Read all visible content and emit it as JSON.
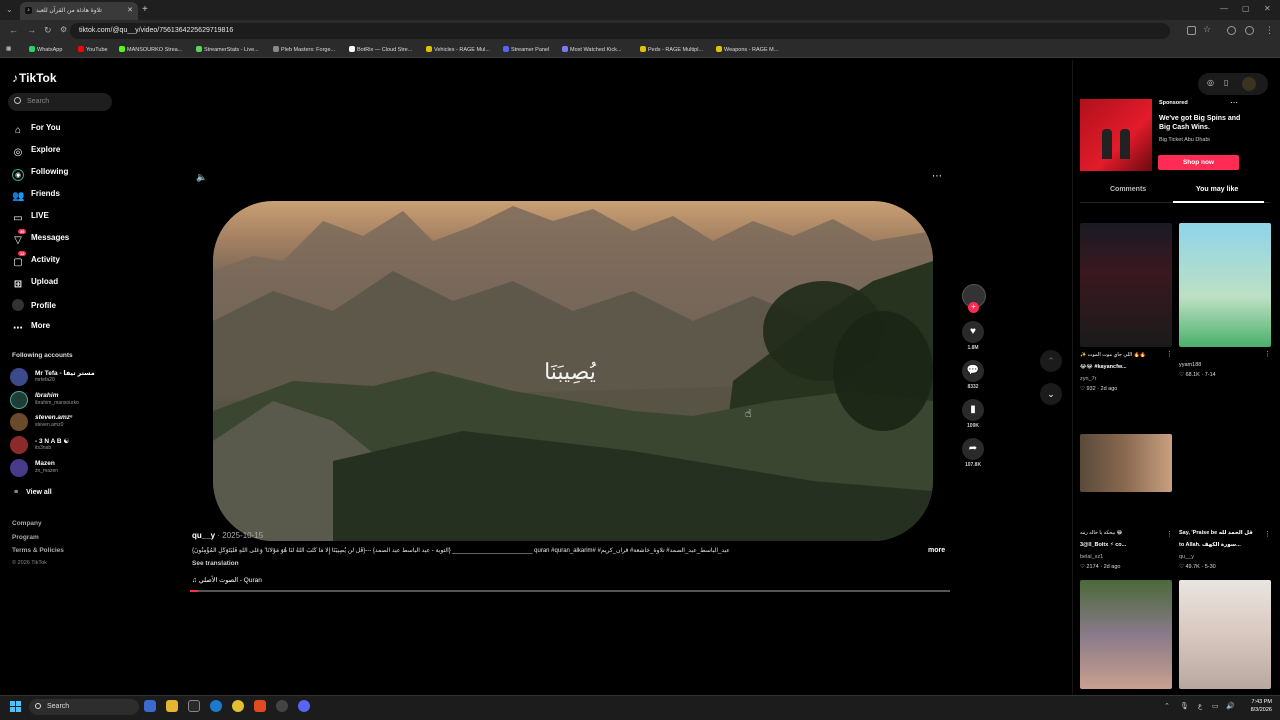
{
  "browser": {
    "tab_title": "تلاوة هادئة من القرآن للعبد",
    "tab_icon": "tiktok-icon",
    "url": "tiktok.com/@qu__y/video/7561364225629719816",
    "bookmarks": [
      {
        "label": "WhatsApp",
        "color": "#25d366"
      },
      {
        "label": "YouTube",
        "color": "#ff0000"
      },
      {
        "label": "MANSOURKO Strea...",
        "color": "#53fc18"
      },
      {
        "label": "StreamerStats - Live...",
        "color": "#5ad35a"
      },
      {
        "label": "Pleb Masters: Forge...",
        "color": "#888888"
      },
      {
        "label": "BotRix — Cloud Stre...",
        "color": "#ffffff"
      },
      {
        "label": "Vehicles - RAGE Mul...",
        "color": "#e0c000"
      },
      {
        "label": "Streamer Panel",
        "color": "#5865f2"
      },
      {
        "label": "Most Watched Kick...",
        "color": "#7a7aff"
      },
      {
        "label": "Peds - RAGE Multipl...",
        "color": "#e0c000"
      },
      {
        "label": "Weapons - RAGE M...",
        "color": "#e0c000"
      }
    ]
  },
  "sidebar": {
    "logo": "TikTok",
    "search_placeholder": "Search",
    "nav": [
      {
        "label": "For You",
        "icon": "home-icon"
      },
      {
        "label": "Explore",
        "icon": "compass-icon"
      },
      {
        "label": "Following",
        "icon": "following-icon"
      },
      {
        "label": "Friends",
        "icon": "friends-icon"
      },
      {
        "label": "LIVE",
        "icon": "live-icon"
      },
      {
        "label": "Messages",
        "icon": "messages-icon",
        "badge": "36"
      },
      {
        "label": "Activity",
        "icon": "activity-icon",
        "badge": "12"
      },
      {
        "label": "Upload",
        "icon": "upload-icon"
      },
      {
        "label": "Profile",
        "icon": "profile-icon"
      },
      {
        "label": "More",
        "icon": "more-icon"
      }
    ],
    "following_heading": "Following accounts",
    "accounts": [
      {
        "name": "Mr Tefa - مستر تيفا",
        "handle": "mrtefa20",
        "color": "#3b4a8a"
      },
      {
        "name": "Ibrahim",
        "handle": "ibrahim_mansourko",
        "color": "#2f6f5f"
      },
      {
        "name": "steven.amz⁶",
        "handle": "steven.amz0",
        "color": "#6b4a2a"
      },
      {
        "name": "- 3 N A B ☯",
        "handle": "its3nab",
        "color": "#8a2a2a"
      },
      {
        "name": "Mazen",
        "handle": "zn_mazen",
        "color": "#4a3a8a"
      }
    ],
    "view_all": "View all",
    "footer": [
      "Company",
      "Program",
      "Terms & Policies"
    ],
    "copyright": "© 2026 TikTok"
  },
  "video": {
    "overlay_text": "يُصِيبَنَا",
    "username": "qu__y",
    "date": "2025-10-15",
    "caption": "عبد_الباسط_عبد_الصمد# تلاوة_خاشعة# قرآن_كريم# #quran #quran_alkarim ________________________ {التوبة - عبد الباسط عبد الصمد} ---{قُل لَّن يُصِيبَنَا إِلَّا مَا كَتَبَ اللَّهُ لَنَا هُوَ مَوْلَانَا ۚ وَعَلَى اللَّهِ فَلْيَتَوَكَّلِ الْمُؤْمِنُونَ}",
    "more": "more",
    "see_translation": "See translation",
    "music": "الصوت الأصلي - Quran",
    "progress": 0.01,
    "likes": "1.8M",
    "comments": "8332",
    "saves": "109K",
    "shares": "107.8K"
  },
  "ad": {
    "sponsored": "Sponsored",
    "title": "We've got Big Spins and Big Cash Wins.",
    "advertiser": "Big Ticket Abu Dhabi",
    "cta": "Shop now"
  },
  "right_tabs": {
    "comments": "Comments",
    "you_may_like": "You may like"
  },
  "recommended": [
    {
      "caption": "😂😂 #kayancfw...",
      "caption_pre": "🔥🔥 اللي جاي موت الموت ✨",
      "user": "zyn_7r",
      "likes": "932",
      "date": "2d ago"
    },
    {
      "caption": "",
      "caption_pre": "",
      "user": "yyam188",
      "likes": "68.1K",
      "date": "7-14"
    },
    {
      "caption": "3@ll_Boltx ⚡ co...",
      "caption_pre": "😂 بيحكه يا خاله رمه",
      "user": "belal_xz1",
      "likes": "2174",
      "date": "2d ago"
    },
    {
      "caption": "to Allah. سورة الكهف...",
      "caption_pre": "Say, 'Praise be قل الحمد لله",
      "user": "qu__y",
      "likes": "49.7K",
      "date": "5-30"
    },
    {
      "caption": "",
      "caption_pre": "",
      "user": "",
      "likes": "",
      "date": ""
    },
    {
      "caption": "",
      "caption_pre": "",
      "user": "",
      "likes": "",
      "date": ""
    }
  ],
  "taskbar": {
    "search": "Search",
    "time": "7:43 PM",
    "date": "8/3/2026"
  }
}
